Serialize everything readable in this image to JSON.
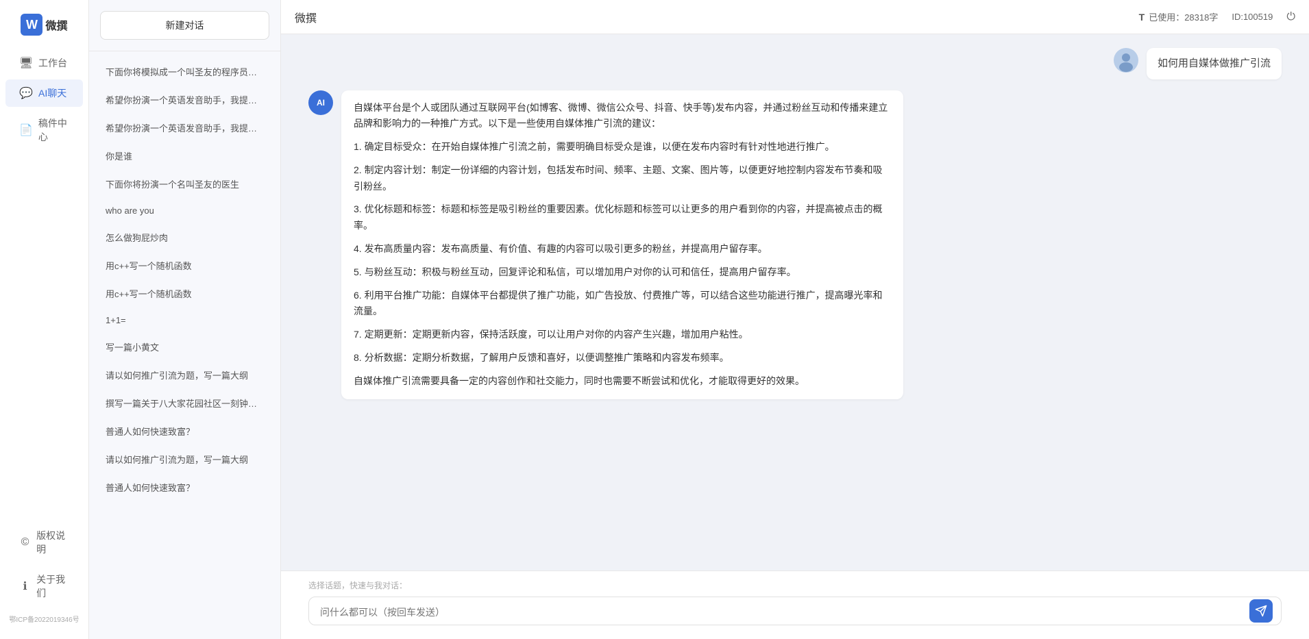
{
  "app": {
    "title": "微撰",
    "logo_letter": "W"
  },
  "topbar": {
    "title": "微撰",
    "usage_label": "已使用：28318字",
    "id_label": "ID:100519",
    "icon_label": "T"
  },
  "nav": {
    "items": [
      {
        "id": "workspace",
        "label": "工作台",
        "icon": "🖥"
      },
      {
        "id": "ai-chat",
        "label": "AI聊天",
        "icon": "💬",
        "active": true
      },
      {
        "id": "drafts",
        "label": "稿件中心",
        "icon": "📄"
      }
    ],
    "bottom_items": [
      {
        "id": "copyright",
        "label": "版权说明",
        "icon": "©"
      },
      {
        "id": "about",
        "label": "关于我们",
        "icon": "ℹ"
      }
    ],
    "icp": "鄂ICP备2022019346号"
  },
  "sidebar": {
    "new_chat_label": "新建对话",
    "chat_items": [
      {
        "id": 1,
        "text": "下面你将模拟成一个叫圣友的程序员、我说..."
      },
      {
        "id": 2,
        "text": "希望你扮演一个英语发音助手，我提供给你..."
      },
      {
        "id": 3,
        "text": "希望你扮演一个英语发音助手，我提供给你..."
      },
      {
        "id": 4,
        "text": "你是谁",
        "active": false
      },
      {
        "id": 5,
        "text": "下面你将扮演一个名叫圣友的医生"
      },
      {
        "id": 6,
        "text": "who are you"
      },
      {
        "id": 7,
        "text": "怎么做狗屁炒肉"
      },
      {
        "id": 8,
        "text": "用c++写一个随机函数"
      },
      {
        "id": 9,
        "text": "用c++写一个随机函数"
      },
      {
        "id": 10,
        "text": "1+1="
      },
      {
        "id": 11,
        "text": "写一篇小黄文"
      },
      {
        "id": 12,
        "text": "请以如何推广引流为题，写一篇大纲"
      },
      {
        "id": 13,
        "text": "撰写一篇关于八大家花园社区一刻钟便民生..."
      },
      {
        "id": 14,
        "text": "普通人如何快速致富？"
      },
      {
        "id": 15,
        "text": "请以如何推广引流为题，写一篇大纲"
      },
      {
        "id": 16,
        "text": "普通人如何快速致富？"
      }
    ]
  },
  "chat": {
    "user_message": "如何用自媒体做推广引流",
    "assistant_response": {
      "paragraphs": [
        "自媒体平台是个人或团队通过互联网平台(如博客、微博、微信公众号、抖音、快手等)发布内容，并通过粉丝互动和传播来建立品牌和影响力的一种推广方式。以下是一些使用自媒体推广引流的建议：",
        "1. 确定目标受众：在开始自媒体推广引流之前，需要明确目标受众是谁，以便在发布内容时有针对性地进行推广。",
        "2. 制定内容计划：制定一份详细的内容计划，包括发布时间、频率、主题、文案、图片等，以便更好地控制内容发布节奏和吸引粉丝。",
        "3. 优化标题和标签：标题和标签是吸引粉丝的重要因素。优化标题和标签可以让更多的用户看到你的内容，并提高被点击的概率。",
        "4. 发布高质量内容：发布高质量、有价值、有趣的内容可以吸引更多的粉丝，并提高用户留存率。",
        "5. 与粉丝互动：积极与粉丝互动，回复评论和私信，可以增加用户对你的认可和信任，提高用户留存率。",
        "6. 利用平台推广功能：自媒体平台都提供了推广功能，如广告投放、付费推广等，可以结合这些功能进行推广，提高曝光率和流量。",
        "7. 定期更新：定期更新内容，保持活跃度，可以让用户对你的内容产生兴趣，增加用户粘性。",
        "8. 分析数据：定期分析数据，了解用户反馈和喜好，以便调整推广策略和内容发布频率。",
        "自媒体推广引流需要具备一定的内容创作和社交能力，同时也需要不断尝试和优化，才能取得更好的效果。"
      ]
    }
  },
  "input": {
    "placeholder": "问什么都可以（按回车发送）",
    "quick_select_label": "选择话题，快速与我对话："
  }
}
